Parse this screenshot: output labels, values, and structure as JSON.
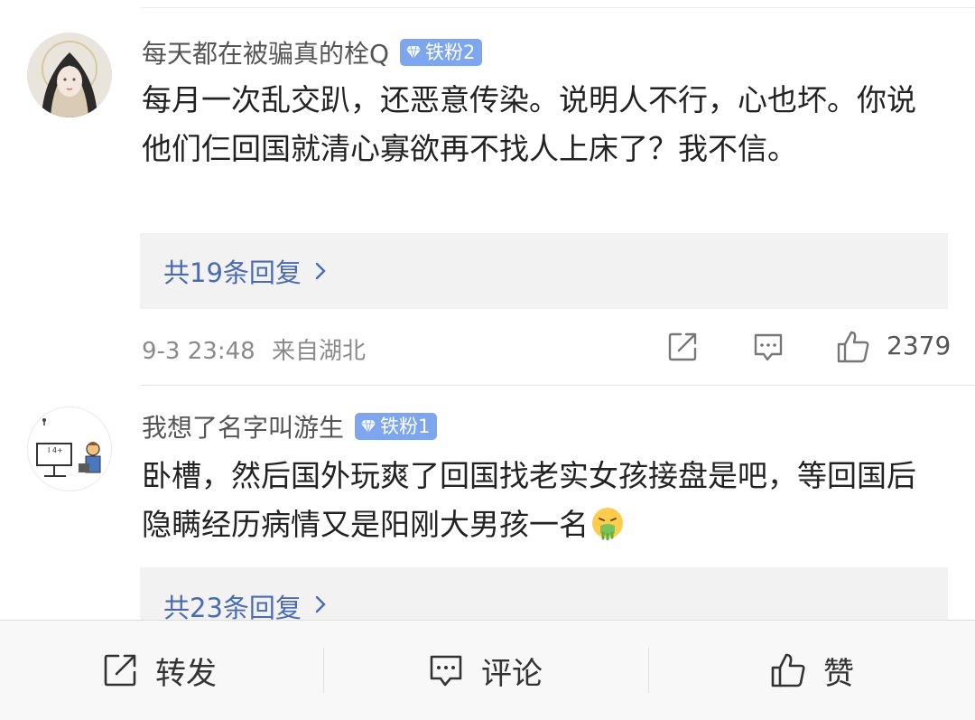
{
  "comments": [
    {
      "username": "每天都在被骗真的栓Q",
      "badge": "铁粉2",
      "text": "每月一次乱交趴，还恶意传染。说明人不行，心也坏。你说他们仨回国就清心寡欲再不找人上床了？我不信。",
      "replies_label": "共19条回复",
      "timestamp": "9-3 23:48",
      "location": "来自湖北",
      "like_count": "2379"
    },
    {
      "username": "我想了名字叫游生",
      "badge": "铁粉1",
      "text": "卧槽，然后国外玩爽了回国找老实女孩接盘是吧，等回国后隐瞒经历病情又是阳刚大男孩一名",
      "emoji": "vomit-face-emoji",
      "replies_label": "共23条回复"
    }
  ],
  "bottom_bar": {
    "repost_label": "转发",
    "comment_label": "评论",
    "like_label": "赞"
  },
  "colors": {
    "badge": "#7ea6ee",
    "reply_link": "#4a6bb3",
    "reply_box": "#f2f2f2",
    "meta_text": "#8a8a8a"
  }
}
